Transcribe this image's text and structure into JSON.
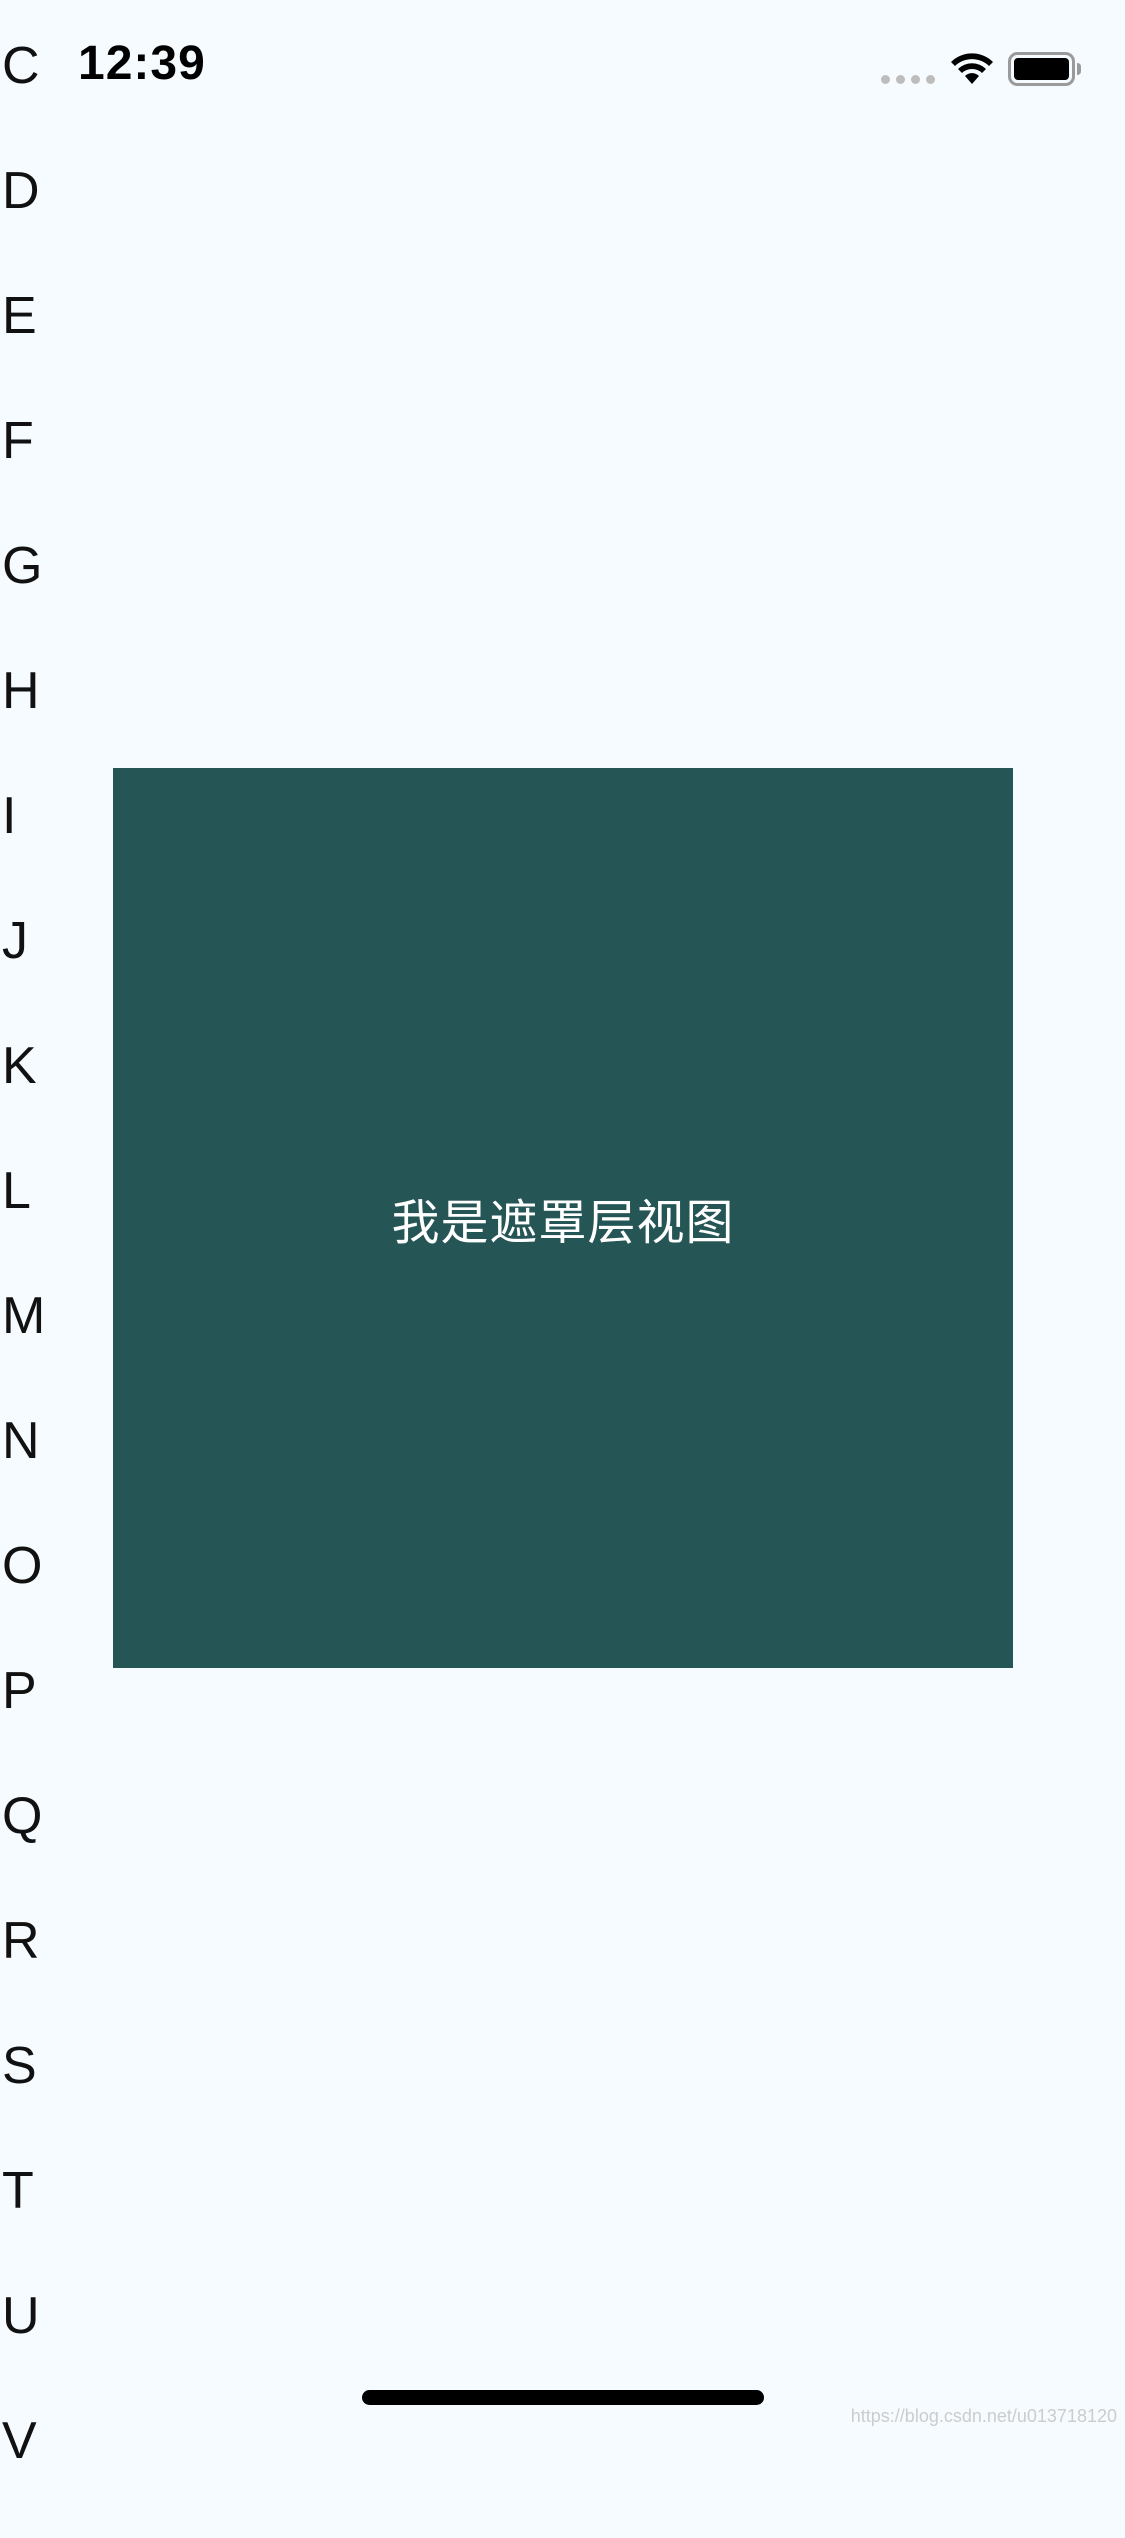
{
  "status_bar": {
    "time": "12:39"
  },
  "index_letters": [
    "C",
    "D",
    "E",
    "F",
    "G",
    "H",
    "I",
    "J",
    "K",
    "L",
    "M",
    "N",
    "O",
    "P",
    "Q",
    "R",
    "S",
    "T",
    "U",
    "V"
  ],
  "mask": {
    "text": "我是遮罩层视图",
    "background_color": "#255555"
  },
  "watermark": "https://blog.csdn.net/u013718120"
}
